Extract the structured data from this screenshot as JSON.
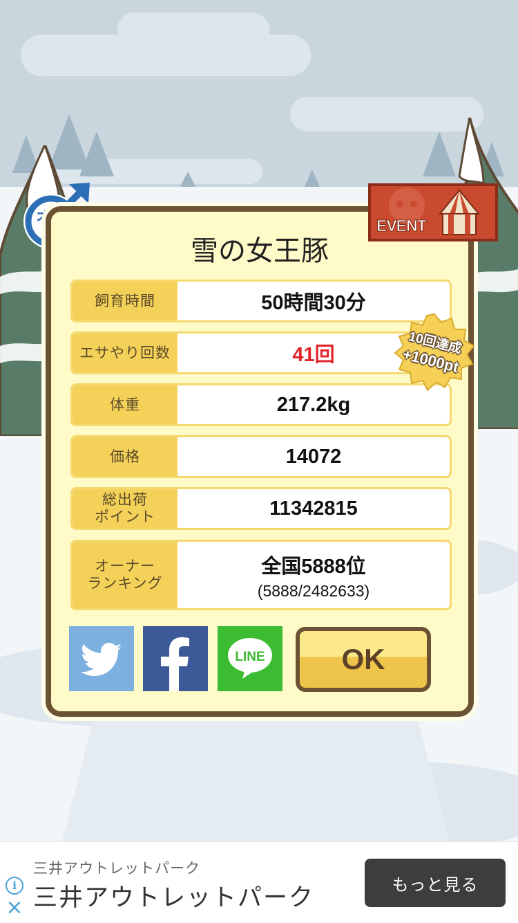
{
  "pig": {
    "gender_label": "オス",
    "name": "雪の女王豚"
  },
  "event_badge": {
    "label": "EVENT"
  },
  "stats": [
    {
      "label": "飼育時間",
      "value": "50時間30分",
      "highlight": false
    },
    {
      "label": "エサやり回数",
      "value": "41回",
      "highlight": true
    },
    {
      "label": "体重",
      "value": "217.2kg",
      "highlight": false
    },
    {
      "label": "価格",
      "value": "14072",
      "highlight": false
    },
    {
      "label": "総出荷\nポイント",
      "value": "11342815",
      "highlight": false
    },
    {
      "label": "オーナー\nランキング",
      "value": "全国5888位",
      "sub_value": "(5888/2482633)",
      "highlight": false
    }
  ],
  "bonus_badge": {
    "line1": "10回達成",
    "line2": "+1000pt"
  },
  "share": {
    "twitter_icon": "twitter-bird-icon",
    "facebook_icon": "facebook-f-icon",
    "line_label": "LINE"
  },
  "ok_button": {
    "label": "OK"
  },
  "ad": {
    "sponsor": "三井アウトレットパーク",
    "headline": "三井アウトレットパーク",
    "cta": "もっと見る",
    "info_icon": "i",
    "close_icon": "×"
  },
  "colors": {
    "dialog_bg": "#fffbc8",
    "dialog_border": "#6b5233",
    "label_bg": "#f4d25a",
    "highlight_value": "#e0242b",
    "male_blue": "#2d6fb7",
    "event_red": "#c94a2e",
    "twitter": "#7bb0e0",
    "facebook": "#3c5998",
    "line": "#3cbc33"
  }
}
